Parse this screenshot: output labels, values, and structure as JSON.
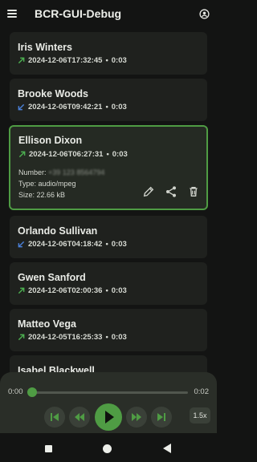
{
  "app": {
    "title": "BCR-GUI-Debug"
  },
  "recordings": [
    {
      "name": "Iris Winters",
      "direction": "outgoing",
      "timestamp": "2024-12-06T17:32:45",
      "duration": "0:03"
    },
    {
      "name": "Brooke Woods",
      "direction": "incoming",
      "timestamp": "2024-12-06T09:42:21",
      "duration": "0:03"
    },
    {
      "name": "Ellison Dixon",
      "direction": "outgoing",
      "timestamp": "2024-12-06T06:27:31",
      "duration": "0:03",
      "expanded": true,
      "number_label": "Number:",
      "number_value": "+39 123 8564794",
      "type_label": "Type:",
      "type_value": "audio/mpeg",
      "size_label": "Size:",
      "size_value": "22.66 kB"
    },
    {
      "name": "Orlando Sullivan",
      "direction": "incoming",
      "timestamp": "2024-12-06T04:18:42",
      "duration": "0:03"
    },
    {
      "name": "Gwen Sanford",
      "direction": "outgoing",
      "timestamp": "2024-12-06T02:00:36",
      "duration": "0:03"
    },
    {
      "name": "Matteo Vega",
      "direction": "outgoing",
      "timestamp": "2024-12-05T16:25:33",
      "duration": "0:03"
    },
    {
      "name": "Isabel Blackwell",
      "direction": "",
      "timestamp": "",
      "duration": ""
    }
  ],
  "separator": "•",
  "player": {
    "current_time": "0:00",
    "total_time": "0:02",
    "progress": 0.0,
    "speed": "1.5x"
  },
  "colors": {
    "accent": "#4f9c44",
    "outgoing": "#4caf50",
    "incoming": "#4a7fd6",
    "background": "#131413",
    "card": "#1f211e"
  },
  "icons": {
    "menu": "menu-icon",
    "account": "account-circle-icon",
    "outgoing": "arrow-up-right-icon",
    "incoming": "arrow-down-left-icon",
    "edit": "pencil-icon",
    "share": "share-icon",
    "delete": "trash-icon",
    "skip_previous": "skip-previous-icon",
    "rewind": "rewind-icon",
    "play": "play-icon",
    "fast_forward": "fast-forward-icon",
    "skip_next": "skip-next-icon"
  }
}
